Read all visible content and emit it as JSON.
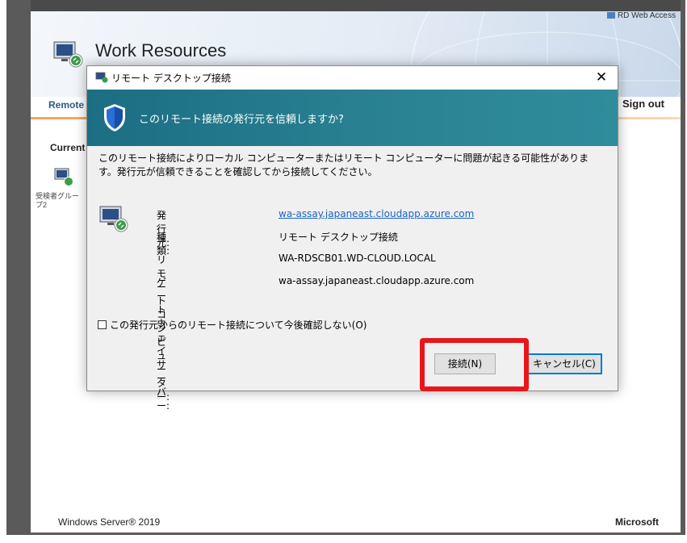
{
  "header": {
    "rd_web_access": "RD Web Access",
    "app_title": "Work Resources"
  },
  "nav": {
    "remote": "Remote",
    "sign_out": "Sign out"
  },
  "content": {
    "current": "Current",
    "folder_label": "受検者グループ2"
  },
  "footer": {
    "windows_server": "Windows Server® 2019",
    "microsoft": "Microsoft"
  },
  "dialog": {
    "title": "リモート デスクトップ接続",
    "close": "✕",
    "banner_question": "このリモート接続の発行元を信頼しますか?",
    "warning": "このリモート接続によりローカル コンピューターまたはリモート コンピューターに問題が起きる可能性があります。発行元が信頼できることを確認してから接続してください。",
    "publisher_label": "発行元:",
    "publisher_value": "wa-assay.japaneast.cloudapp.azure.com",
    "type_label": "種類:",
    "type_value": "リモート デスクトップ接続",
    "remote_computer_label": "リモート コンピューター:",
    "remote_computer_value": "WA-RDSCB01.WD-CLOUD.LOCAL",
    "gateway_label": "ゲートウェイ サーバー:",
    "gateway_value": "wa-assay.japaneast.cloudapp.azure.com",
    "dont_ask_checkbox": "この発行元からのリモート接続について今後確認しない(O)",
    "dont_ask_checked": false,
    "connect_button": "接続(N)",
    "cancel_button": "キャンセル(C)"
  },
  "colors": {
    "banner": "#1c6e83",
    "highlight": "#e8161b",
    "link": "#1a64c8",
    "nav_accent": "#f5a35a"
  },
  "icons": {
    "rd_web": "rd-web-icon",
    "app": "remote-desktop-icon",
    "shield": "shield-icon",
    "publisher": "remote-desktop-icon",
    "folder": "remote-desktop-icon"
  }
}
